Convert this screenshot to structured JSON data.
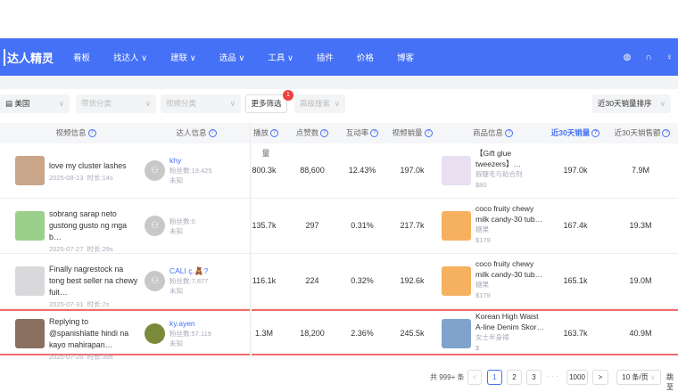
{
  "nav": {
    "logo": "达人精灵",
    "items": [
      "看板",
      "找达人 ∨",
      "建联 ∨",
      "选品 ∨",
      "工具 ∨",
      "插件",
      "价格",
      "博客"
    ]
  },
  "filters": {
    "country": "美国",
    "category": "带货分类",
    "video_category": "视频分类",
    "more": "更多筛选",
    "more_badge": "1",
    "advanced": "高级搜索",
    "sort": "近30天销量排序"
  },
  "columns": [
    "视频信息",
    "达人信息",
    "播放量",
    "点赞数",
    "互动率",
    "视频销量",
    "商品信息",
    "近30天销量",
    "近30天销售额"
  ],
  "rows": [
    {
      "title": "love my cluster lashes",
      "date": "2025-08-13",
      "duration": "时长:14s",
      "creator": "khy",
      "fans": "粉丝数:19,425",
      "region": "未知",
      "views": "800.3k",
      "likes": "88,600",
      "rate": "12.43%",
      "video_sales": "197.0k",
      "product": "【Gift glue tweezers】…",
      "product_cat": "假睫毛与粘合剂",
      "price": "$80",
      "sales30": "197.0k",
      "revenue30": "7.9M",
      "thumb": "#c9a58a",
      "pimg": "#e8dff0"
    },
    {
      "title": "sobrang sarap neto gustong gusto ng mga b…",
      "date": "2025-07-27",
      "duration": "时长:29s",
      "creator": "",
      "fans": "粉丝数:0",
      "region": "未知",
      "views": "135.7k",
      "likes": "297",
      "rate": "0.31%",
      "video_sales": "217.7k",
      "product": "coco fruity chewy milk candy-30 tub…",
      "product_cat": "糖果",
      "price": "$179",
      "sales30": "167.4k",
      "revenue30": "19.3M",
      "thumb": "#9bd08a",
      "pimg": "#f5b060"
    },
    {
      "title": "Finally nagrestock na tong best seller na chewy fuit…",
      "date": "2025-07-31",
      "duration": "时长:7s",
      "creator": "CALI ç.🧸?",
      "fans": "粉丝数:7,877",
      "region": "未知",
      "views": "116.1k",
      "likes": "224",
      "rate": "0.32%",
      "video_sales": "192.6k",
      "product": "coco fruity chewy milk candy-30 tub…",
      "product_cat": "糖果",
      "price": "$179",
      "sales30": "165.1k",
      "revenue30": "19.0M",
      "thumb": "#d9d9dc",
      "pimg": "#f5b060"
    },
    {
      "title": "Replying to @spanishlatte hindi na kayo mahirapan…",
      "date": "2025-07-25",
      "duration": "时长:39s",
      "creator": "ky.ayen",
      "fans": "粉丝数:57,119",
      "region": "未知",
      "views": "1.3M",
      "likes": "18,200",
      "rate": "2.36%",
      "video_sales": "245.5k",
      "product": "Korean High Waist A-line Denim Skor…",
      "product_cat": "女士半身裙",
      "price": "$",
      "sales30": "163.7k",
      "revenue30": "40.9M",
      "thumb": "#8a7060",
      "pimg": "#7fa3cc"
    }
  ],
  "pagination": {
    "total": "共 999+ 条",
    "pages": [
      "1",
      "2",
      "3"
    ],
    "ellipsis": "· · ·",
    "last": "1000",
    "per_page": "10 条/页",
    "jump": "跳至"
  }
}
